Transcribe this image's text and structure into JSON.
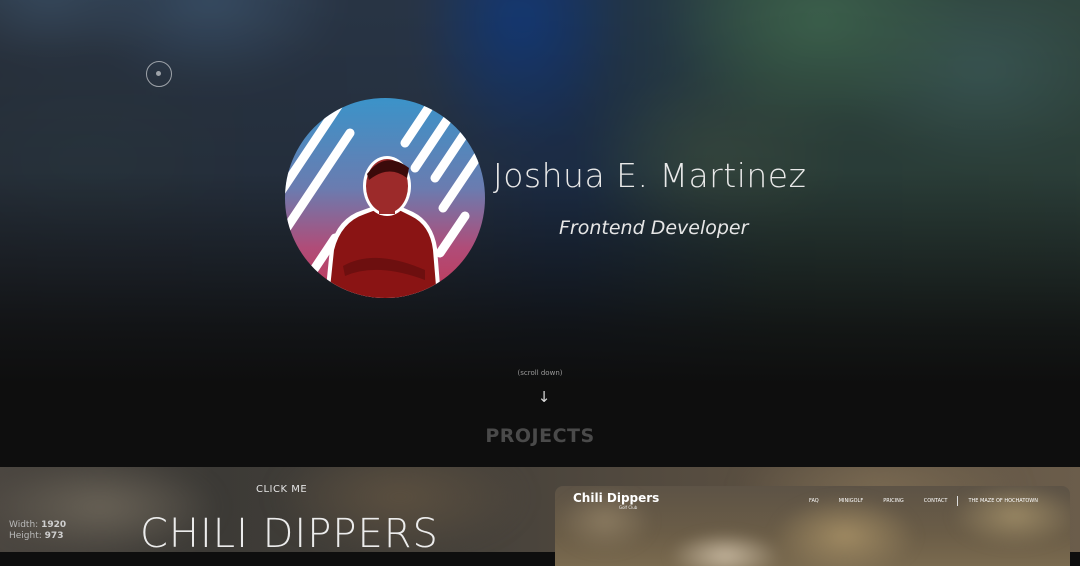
{
  "hero": {
    "name": "Joshua E. Martinez",
    "role": "Frontend Developer",
    "scroll_hint": "(scroll down)",
    "scroll_icon": "arrow-down-icon"
  },
  "projects": {
    "title": "PROJECTS",
    "click_me": "CLICK ME",
    "current_name": "CHILI DIPPERS",
    "preview": {
      "brand": "Chili Dippers",
      "sub": "Golf Club",
      "nav": [
        "FAQ",
        "MINIGOLF",
        "PRICING",
        "CONTACT",
        "THE MAZE OF HOCHATOWN"
      ]
    }
  },
  "viewport": {
    "width_label": "Width:",
    "width_value": "1920",
    "height_label": "Height:",
    "height_value": "973"
  },
  "colors": {
    "avatar_top": "#3b93c9",
    "avatar_bottom": "#c13a58",
    "shirt": "#8a1414",
    "background": "#0e0e0e"
  }
}
